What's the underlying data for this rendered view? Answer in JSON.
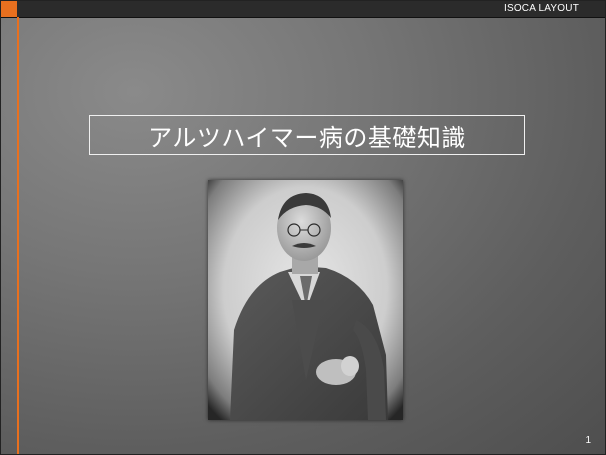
{
  "header": {
    "brand_label": "ISOCA LAYOUT"
  },
  "slide": {
    "title": "アルツハイマー病の基礎知識",
    "page_number": "1"
  },
  "colors": {
    "accent": "#e8701f",
    "topbar": "#2b2b2b",
    "background": "#6a6a6a",
    "title_text": "#ffffff"
  },
  "image": {
    "icon": "portrait-photo"
  }
}
